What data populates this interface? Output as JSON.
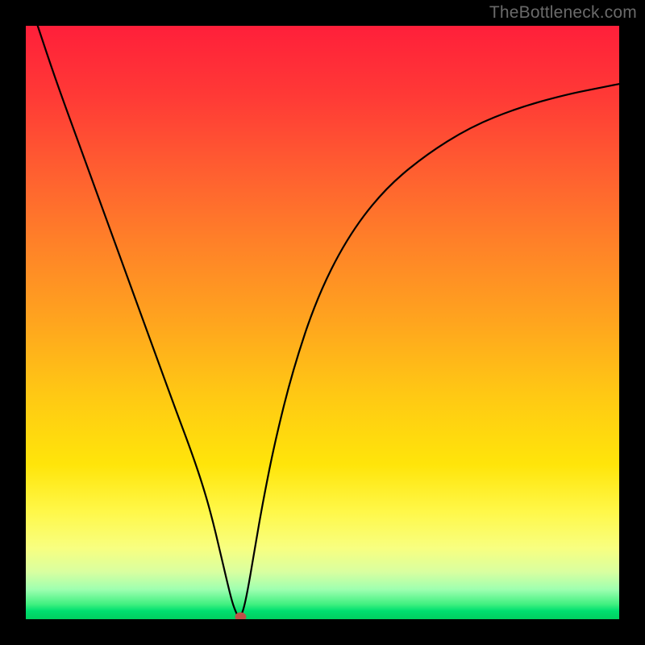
{
  "watermark": "TheBottleneck.com",
  "chart_data": {
    "type": "line",
    "title": "",
    "xlabel": "",
    "ylabel": "",
    "xlim": [
      0,
      1
    ],
    "ylim": [
      0,
      1
    ],
    "grid": false,
    "legend": false,
    "series": [
      {
        "name": "curve",
        "x": [
          0.02,
          0.05,
          0.09,
          0.13,
          0.17,
          0.21,
          0.25,
          0.28,
          0.3,
          0.314,
          0.326,
          0.34,
          0.348,
          0.354,
          0.358,
          0.362,
          0.368,
          0.376,
          0.386,
          0.4,
          0.42,
          0.45,
          0.49,
          0.54,
          0.6,
          0.67,
          0.75,
          0.83,
          0.91,
          0.97,
          1.0
        ],
        "y": [
          1.0,
          0.91,
          0.8,
          0.69,
          0.58,
          0.47,
          0.36,
          0.28,
          0.22,
          0.17,
          0.12,
          0.06,
          0.028,
          0.012,
          0.004,
          0.004,
          0.02,
          0.06,
          0.12,
          0.2,
          0.3,
          0.42,
          0.54,
          0.64,
          0.72,
          0.78,
          0.83,
          0.862,
          0.884,
          0.896,
          0.902
        ]
      }
    ],
    "marker": {
      "x": 0.362,
      "y": 0.004,
      "color": "#c05048"
    },
    "background_gradient_stops": [
      {
        "pos": 0.0,
        "color": "#ff1f3a"
      },
      {
        "pos": 0.12,
        "color": "#ff3a36"
      },
      {
        "pos": 0.25,
        "color": "#ff6030"
      },
      {
        "pos": 0.37,
        "color": "#ff8228"
      },
      {
        "pos": 0.5,
        "color": "#ffa51e"
      },
      {
        "pos": 0.62,
        "color": "#ffc814"
      },
      {
        "pos": 0.74,
        "color": "#ffe50a"
      },
      {
        "pos": 0.82,
        "color": "#fff84a"
      },
      {
        "pos": 0.88,
        "color": "#f8ff80"
      },
      {
        "pos": 0.92,
        "color": "#d9ffa0"
      },
      {
        "pos": 0.95,
        "color": "#9effb0"
      },
      {
        "pos": 0.975,
        "color": "#40f080"
      },
      {
        "pos": 0.986,
        "color": "#00e070"
      },
      {
        "pos": 0.992,
        "color": "#00d868"
      },
      {
        "pos": 1.0,
        "color": "#00d060"
      }
    ]
  }
}
